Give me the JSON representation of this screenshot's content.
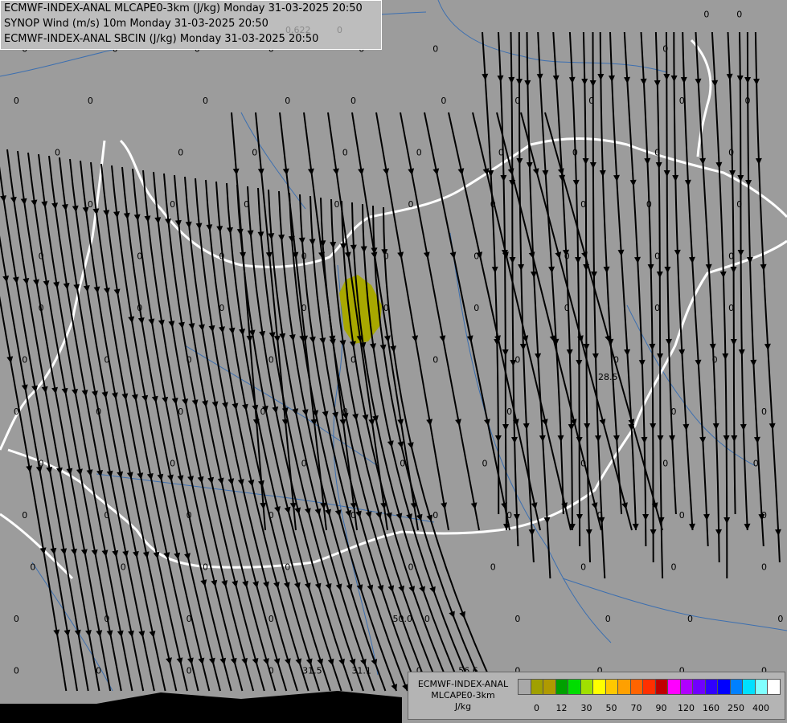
{
  "header": {
    "line1": "ECMWF-INDEX-ANAL MLCAPE0-3km (J/kg) Monday 31-03-2025 20:50",
    "line2": "SYNOP Wind (m/s) 10m Monday 31-03-2025 20:50",
    "line3": "ECMWF-INDEX-ANAL SBCIN (J/kg) Monday 31-03-2025 20:50",
    "overlay_values": [
      "0.622",
      "0"
    ]
  },
  "legend": {
    "title1": "ECMWF-INDEX-ANAL",
    "title2": "MLCAPE0-3km",
    "unit": "J/kg",
    "colors": [
      "#a8a8a8",
      "#a0a000",
      "#b09a00",
      "#00a000",
      "#00dd00",
      "#a0e000",
      "#ffff00",
      "#ffc800",
      "#ffa000",
      "#ff6400",
      "#ff3000",
      "#c00000",
      "#ff00ff",
      "#b000ff",
      "#7000ff",
      "#3000ff",
      "#0000ff",
      "#0080ff",
      "#00e0ff",
      "#80ffff",
      "#ffffff"
    ],
    "ticks": [
      "0",
      "12",
      "30",
      "50",
      "70",
      "90",
      "120",
      "160",
      "250",
      "400"
    ]
  },
  "map": {
    "cape_patch_color": "#a8a800",
    "station_values": [
      {
        "v": "0",
        "x": 20.9,
        "y": 48.9
      },
      {
        "v": "0",
        "x": 21.3,
        "y": 48.9
      },
      {
        "v": "0",
        "x": 22.4,
        "y": 48.9
      },
      {
        "v": "0",
        "x": 23.5,
        "y": 48.9
      },
      {
        "v": "0",
        "x": 24.8,
        "y": 48.9
      },
      {
        "v": "0",
        "x": 12.6,
        "y": 48.7
      },
      {
        "v": "0",
        "x": 13.7,
        "y": 48.7
      },
      {
        "v": "0",
        "x": 14.7,
        "y": 48.7
      },
      {
        "v": "0",
        "x": 15.6,
        "y": 48.7
      },
      {
        "v": "0",
        "x": 16.7,
        "y": 48.7
      },
      {
        "v": "0",
        "x": 17.6,
        "y": 48.7
      },
      {
        "v": "0",
        "x": 20.4,
        "y": 48.7
      },
      {
        "v": "0",
        "x": 12.5,
        "y": 48.4
      },
      {
        "v": "0",
        "x": 13.4,
        "y": 48.4
      },
      {
        "v": "0",
        "x": 14.8,
        "y": 48.4
      },
      {
        "v": "0",
        "x": 15.8,
        "y": 48.4
      },
      {
        "v": "0",
        "x": 16.6,
        "y": 48.4
      },
      {
        "v": "0",
        "x": 17.7,
        "y": 48.4
      },
      {
        "v": "0",
        "x": 18.6,
        "y": 48.4
      },
      {
        "v": "0",
        "x": 19.5,
        "y": 48.4
      },
      {
        "v": "0",
        "x": 20.6,
        "y": 48.4
      },
      {
        "v": "0",
        "x": 21.4,
        "y": 48.4
      },
      {
        "v": "0",
        "x": 22.5,
        "y": 48.4
      },
      {
        "v": "0",
        "x": 23.4,
        "y": 48.4
      },
      {
        "v": "0",
        "x": 24.4,
        "y": 48.4
      },
      {
        "v": "0",
        "x": 13.0,
        "y": 48.1
      },
      {
        "v": "0",
        "x": 14.5,
        "y": 48.1
      },
      {
        "v": "0",
        "x": 15.4,
        "y": 48.1
      },
      {
        "v": "0",
        "x": 16.5,
        "y": 48.1
      },
      {
        "v": "0",
        "x": 17.4,
        "y": 48.1
      },
      {
        "v": "0",
        "x": 18.4,
        "y": 48.1
      },
      {
        "v": "0",
        "x": 19.3,
        "y": 48.1
      },
      {
        "v": "0",
        "x": 20.3,
        "y": 48.1
      },
      {
        "v": "0",
        "x": 21.2,
        "y": 48.1
      },
      {
        "v": "0",
        "x": 22.2,
        "y": 48.1
      },
      {
        "v": "0",
        "x": 23.0,
        "y": 48.1
      },
      {
        "v": "0",
        "x": 24.1,
        "y": 48.1
      },
      {
        "v": "0",
        "x": 13.4,
        "y": 47.8
      },
      {
        "v": "0",
        "x": 14.4,
        "y": 47.8
      },
      {
        "v": "0",
        "x": 15.3,
        "y": 47.8
      },
      {
        "v": "0",
        "x": 16.4,
        "y": 47.8
      },
      {
        "v": "0",
        "x": 17.3,
        "y": 47.8
      },
      {
        "v": "0",
        "x": 18.3,
        "y": 47.8
      },
      {
        "v": "0",
        "x": 19.4,
        "y": 47.8
      },
      {
        "v": "0",
        "x": 20.2,
        "y": 47.8
      },
      {
        "v": "0",
        "x": 21.3,
        "y": 47.8
      },
      {
        "v": "0",
        "x": 22.3,
        "y": 47.8
      },
      {
        "v": "0",
        "x": 23.3,
        "y": 47.8
      },
      {
        "v": "0",
        "x": 24.2,
        "y": 47.8
      },
      {
        "v": "0",
        "x": 12.8,
        "y": 47.5
      },
      {
        "v": "0",
        "x": 14.0,
        "y": 47.5
      },
      {
        "v": "0",
        "x": 15.0,
        "y": 47.5
      },
      {
        "v": "0",
        "x": 16.0,
        "y": 47.5
      },
      {
        "v": "0",
        "x": 17.0,
        "y": 47.5
      },
      {
        "v": "0",
        "x": 18.1,
        "y": 47.5
      },
      {
        "v": "0",
        "x": 19.2,
        "y": 47.5
      },
      {
        "v": "0",
        "x": 20.3,
        "y": 47.5
      },
      {
        "v": "0",
        "x": 21.2,
        "y": 47.5
      },
      {
        "v": "0",
        "x": 22.3,
        "y": 47.5
      },
      {
        "v": "0",
        "x": 23.5,
        "y": 47.5
      },
      {
        "v": "0",
        "x": 24.5,
        "y": 47.5
      },
      {
        "v": "0",
        "x": 12.8,
        "y": 47.2
      },
      {
        "v": "0",
        "x": 14.0,
        "y": 47.2
      },
      {
        "v": "0",
        "x": 15.0,
        "y": 47.2
      },
      {
        "v": "0",
        "x": 16.0,
        "y": 47.2
      },
      {
        "v": "0",
        "x": 17.0,
        "y": 47.2
      },
      {
        "v": "0",
        "x": 18.1,
        "y": 47.2
      },
      {
        "v": "0",
        "x": 19.2,
        "y": 47.2
      },
      {
        "v": "0",
        "x": 20.3,
        "y": 47.2
      },
      {
        "v": "0",
        "x": 21.2,
        "y": 47.2
      },
      {
        "v": "0",
        "x": 22.3,
        "y": 47.2
      },
      {
        "v": "0",
        "x": 23.3,
        "y": 47.2
      },
      {
        "v": "0",
        "x": 12.6,
        "y": 46.9
      },
      {
        "v": "0",
        "x": 13.6,
        "y": 46.9
      },
      {
        "v": "0",
        "x": 14.6,
        "y": 46.9
      },
      {
        "v": "0",
        "x": 15.6,
        "y": 46.9
      },
      {
        "v": "0",
        "x": 16.6,
        "y": 46.9
      },
      {
        "v": "0",
        "x": 17.6,
        "y": 46.9
      },
      {
        "v": "0",
        "x": 18.6,
        "y": 46.9
      },
      {
        "v": "0",
        "x": 19.8,
        "y": 46.9
      },
      {
        "v": "0",
        "x": 21.0,
        "y": 46.9
      },
      {
        "v": "0",
        "x": 22.0,
        "y": 46.9
      },
      {
        "v": "0",
        "x": 23.2,
        "y": 46.9
      },
      {
        "v": "0",
        "x": 12.5,
        "y": 46.6
      },
      {
        "v": "0",
        "x": 13.5,
        "y": 46.6
      },
      {
        "v": "0",
        "x": 14.5,
        "y": 46.6
      },
      {
        "v": "0",
        "x": 15.5,
        "y": 46.6
      },
      {
        "v": "0",
        "x": 16.5,
        "y": 46.6
      },
      {
        "v": "0",
        "x": 18.5,
        "y": 46.6
      },
      {
        "v": "0",
        "x": 20.5,
        "y": 46.6
      },
      {
        "v": "0",
        "x": 21.6,
        "y": 46.6
      },
      {
        "v": "0",
        "x": 22.8,
        "y": 46.6
      },
      {
        "v": "0",
        "x": 12.8,
        "y": 46.3
      },
      {
        "v": "0",
        "x": 14.4,
        "y": 46.3
      },
      {
        "v": "0",
        "x": 16.0,
        "y": 46.3
      },
      {
        "v": "0",
        "x": 17.2,
        "y": 46.3
      },
      {
        "v": "0",
        "x": 18.2,
        "y": 46.3
      },
      {
        "v": "0",
        "x": 19.4,
        "y": 46.3
      },
      {
        "v": "0",
        "x": 20.4,
        "y": 46.3
      },
      {
        "v": "0",
        "x": 21.5,
        "y": 46.3
      },
      {
        "v": "0",
        "x": 22.6,
        "y": 46.3
      },
      {
        "v": "0",
        "x": 23.8,
        "y": 46.3
      },
      {
        "v": "0",
        "x": 12.6,
        "y": 46.0
      },
      {
        "v": "0",
        "x": 13.6,
        "y": 46.0
      },
      {
        "v": "0",
        "x": 14.6,
        "y": 46.0
      },
      {
        "v": "0",
        "x": 15.6,
        "y": 46.0
      },
      {
        "v": "0",
        "x": 16.6,
        "y": 46.0
      },
      {
        "v": "0",
        "x": 17.6,
        "y": 46.0
      },
      {
        "v": "0",
        "x": 18.5,
        "y": 46.0
      },
      {
        "v": "0",
        "x": 19.6,
        "y": 46.0
      },
      {
        "v": "0",
        "x": 20.6,
        "y": 46.0
      },
      {
        "v": "0",
        "x": 21.6,
        "y": 46.0
      },
      {
        "v": "0",
        "x": 22.6,
        "y": 46.0
      },
      {
        "v": "0",
        "x": 23.6,
        "y": 46.0
      },
      {
        "v": "0",
        "x": 12.7,
        "y": 45.7
      },
      {
        "v": "0",
        "x": 13.8,
        "y": 45.7
      },
      {
        "v": "0",
        "x": 14.8,
        "y": 45.7
      },
      {
        "v": "0",
        "x": 15.8,
        "y": 45.7
      },
      {
        "v": "0",
        "x": 17.3,
        "y": 45.7
      },
      {
        "v": "0",
        "x": 18.3,
        "y": 45.7
      },
      {
        "v": "0",
        "x": 19.4,
        "y": 45.7
      },
      {
        "v": "0",
        "x": 20.5,
        "y": 45.7
      },
      {
        "v": "0",
        "x": 21.6,
        "y": 45.7
      },
      {
        "v": "0",
        "x": 22.7,
        "y": 45.7
      },
      {
        "v": "0",
        "x": 23.7,
        "y": 45.7
      },
      {
        "v": "0",
        "x": 12.5,
        "y": 45.4
      },
      {
        "v": "0",
        "x": 13.6,
        "y": 45.4
      },
      {
        "v": "0",
        "x": 14.6,
        "y": 45.4
      },
      {
        "v": "0",
        "x": 15.6,
        "y": 45.4
      },
      {
        "v": "0",
        "x": 17.5,
        "y": 45.4
      },
      {
        "v": "0",
        "x": 18.6,
        "y": 45.4
      },
      {
        "v": "0",
        "x": 19.7,
        "y": 45.4
      },
      {
        "v": "0",
        "x": 20.7,
        "y": 45.4
      },
      {
        "v": "0",
        "x": 21.8,
        "y": 45.4
      },
      {
        "v": "0",
        "x": 22.8,
        "y": 45.4
      },
      {
        "v": "0",
        "x": 23.8,
        "y": 45.4
      },
      {
        "v": "28.5",
        "x": 19.7,
        "y": 46.8
      },
      {
        "v": "50.0",
        "x": 17.2,
        "y": 45.4
      },
      {
        "v": "31.5",
        "x": 16.1,
        "y": 45.1
      },
      {
        "v": "31.1",
        "x": 16.7,
        "y": 45.1
      },
      {
        "v": "56.6",
        "x": 18.0,
        "y": 45.1
      },
      {
        "v": "0",
        "x": 12.5,
        "y": 45.1
      },
      {
        "v": "0",
        "x": 13.5,
        "y": 45.1
      },
      {
        "v": "0",
        "x": 14.6,
        "y": 45.1
      },
      {
        "v": "0",
        "x": 15.6,
        "y": 45.1
      },
      {
        "v": "0",
        "x": 17.4,
        "y": 45.1
      },
      {
        "v": "0",
        "x": 18.6,
        "y": 45.1
      },
      {
        "v": "0",
        "x": 19.6,
        "y": 45.1
      },
      {
        "v": "0",
        "x": 20.6,
        "y": 45.1
      },
      {
        "v": "0",
        "x": 21.6,
        "y": 45.1
      },
      {
        "v": "0",
        "x": 22.6,
        "y": 45.1
      },
      {
        "v": "0",
        "x": 23.6,
        "y": 45.1
      }
    ]
  }
}
